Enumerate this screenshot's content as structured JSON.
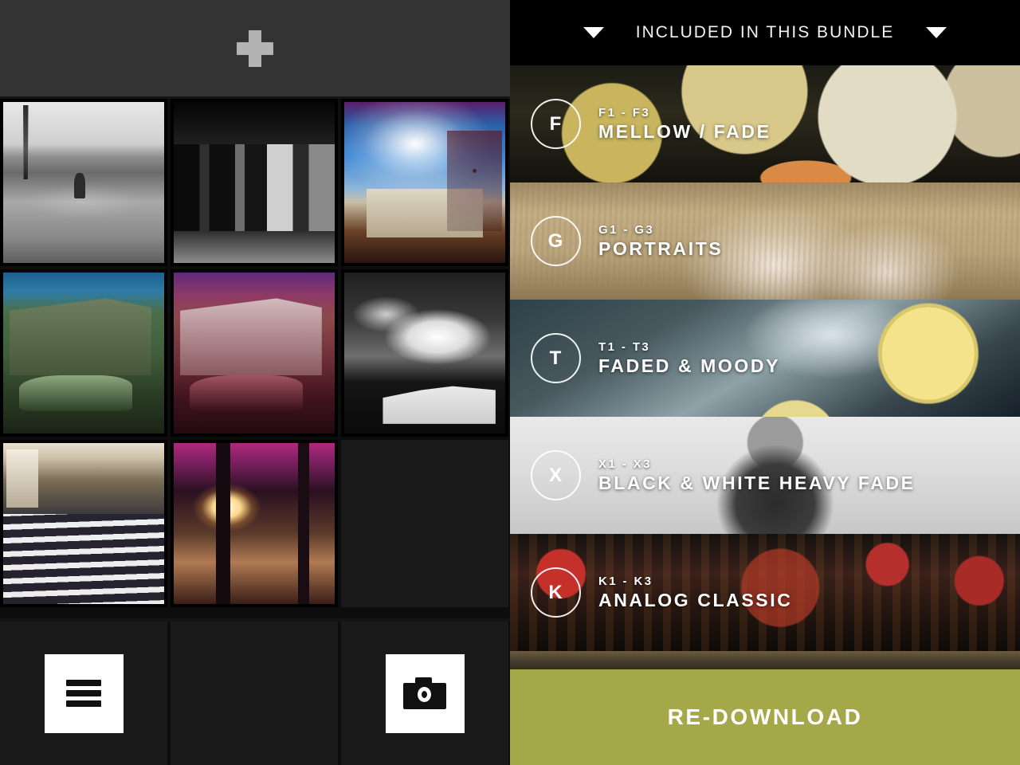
{
  "library": {
    "add_button": {
      "icon": "plus-icon",
      "label": ""
    },
    "photos": [
      {
        "id": "photo-1",
        "art": "ph-path",
        "description": "black and white tree-lined brick path with walking person"
      },
      {
        "id": "photo-2",
        "art": "ph-shop",
        "description": "black and white glass shopfront entrance"
      },
      {
        "id": "photo-3",
        "art": "ph-house",
        "description": "color cross-processed house under blue cloudy sky"
      },
      {
        "id": "photo-4",
        "art": "ph-green",
        "description": "green tinted apartment building with parked car"
      },
      {
        "id": "photo-5",
        "art": "ph-magenta",
        "description": "magenta tinted apartment building with parked car"
      },
      {
        "id": "photo-6",
        "art": "ph-clouds",
        "description": "black and white clouds over white houses"
      },
      {
        "id": "photo-7",
        "art": "ph-cross",
        "description": "wet crosswalk street scene"
      },
      {
        "id": "photo-8",
        "art": "ph-sun",
        "description": "backlit sunset through pole and wet street"
      }
    ],
    "empty_cells": 1,
    "toolbar": {
      "menu_icon": "hamburger-menu-icon",
      "camera_icon": "camera-icon"
    }
  },
  "bundle": {
    "header": {
      "title": "INCLUDED IN THIS BUNDLE",
      "left_caret": "chevron-down-icon",
      "right_caret": "chevron-down-icon"
    },
    "packs": [
      {
        "badge": "F",
        "range": "F1 - F3",
        "name": "MELLOW / FADE",
        "art": "bg-pears"
      },
      {
        "badge": "G",
        "range": "G1 - G3",
        "name": "PORTRAITS",
        "art": "bg-field"
      },
      {
        "badge": "T",
        "range": "T1 - T3",
        "name": "FADED & MOODY",
        "art": "bg-lemon"
      },
      {
        "badge": "X",
        "range": "X1 - X3",
        "name": "BLACK & WHITE HEAVY FADE",
        "art": "bg-bw"
      },
      {
        "badge": "K",
        "range": "K1 - K3",
        "name": "ANALOG CLASSIC",
        "art": "bg-lanterns"
      }
    ],
    "redownload_label": "RE-DOWNLOAD"
  },
  "colors": {
    "accent_olive": "#a5a849",
    "panel_dark": "#141414",
    "add_bar": "#333333",
    "header_black": "#000000",
    "text_white": "#ffffff"
  }
}
